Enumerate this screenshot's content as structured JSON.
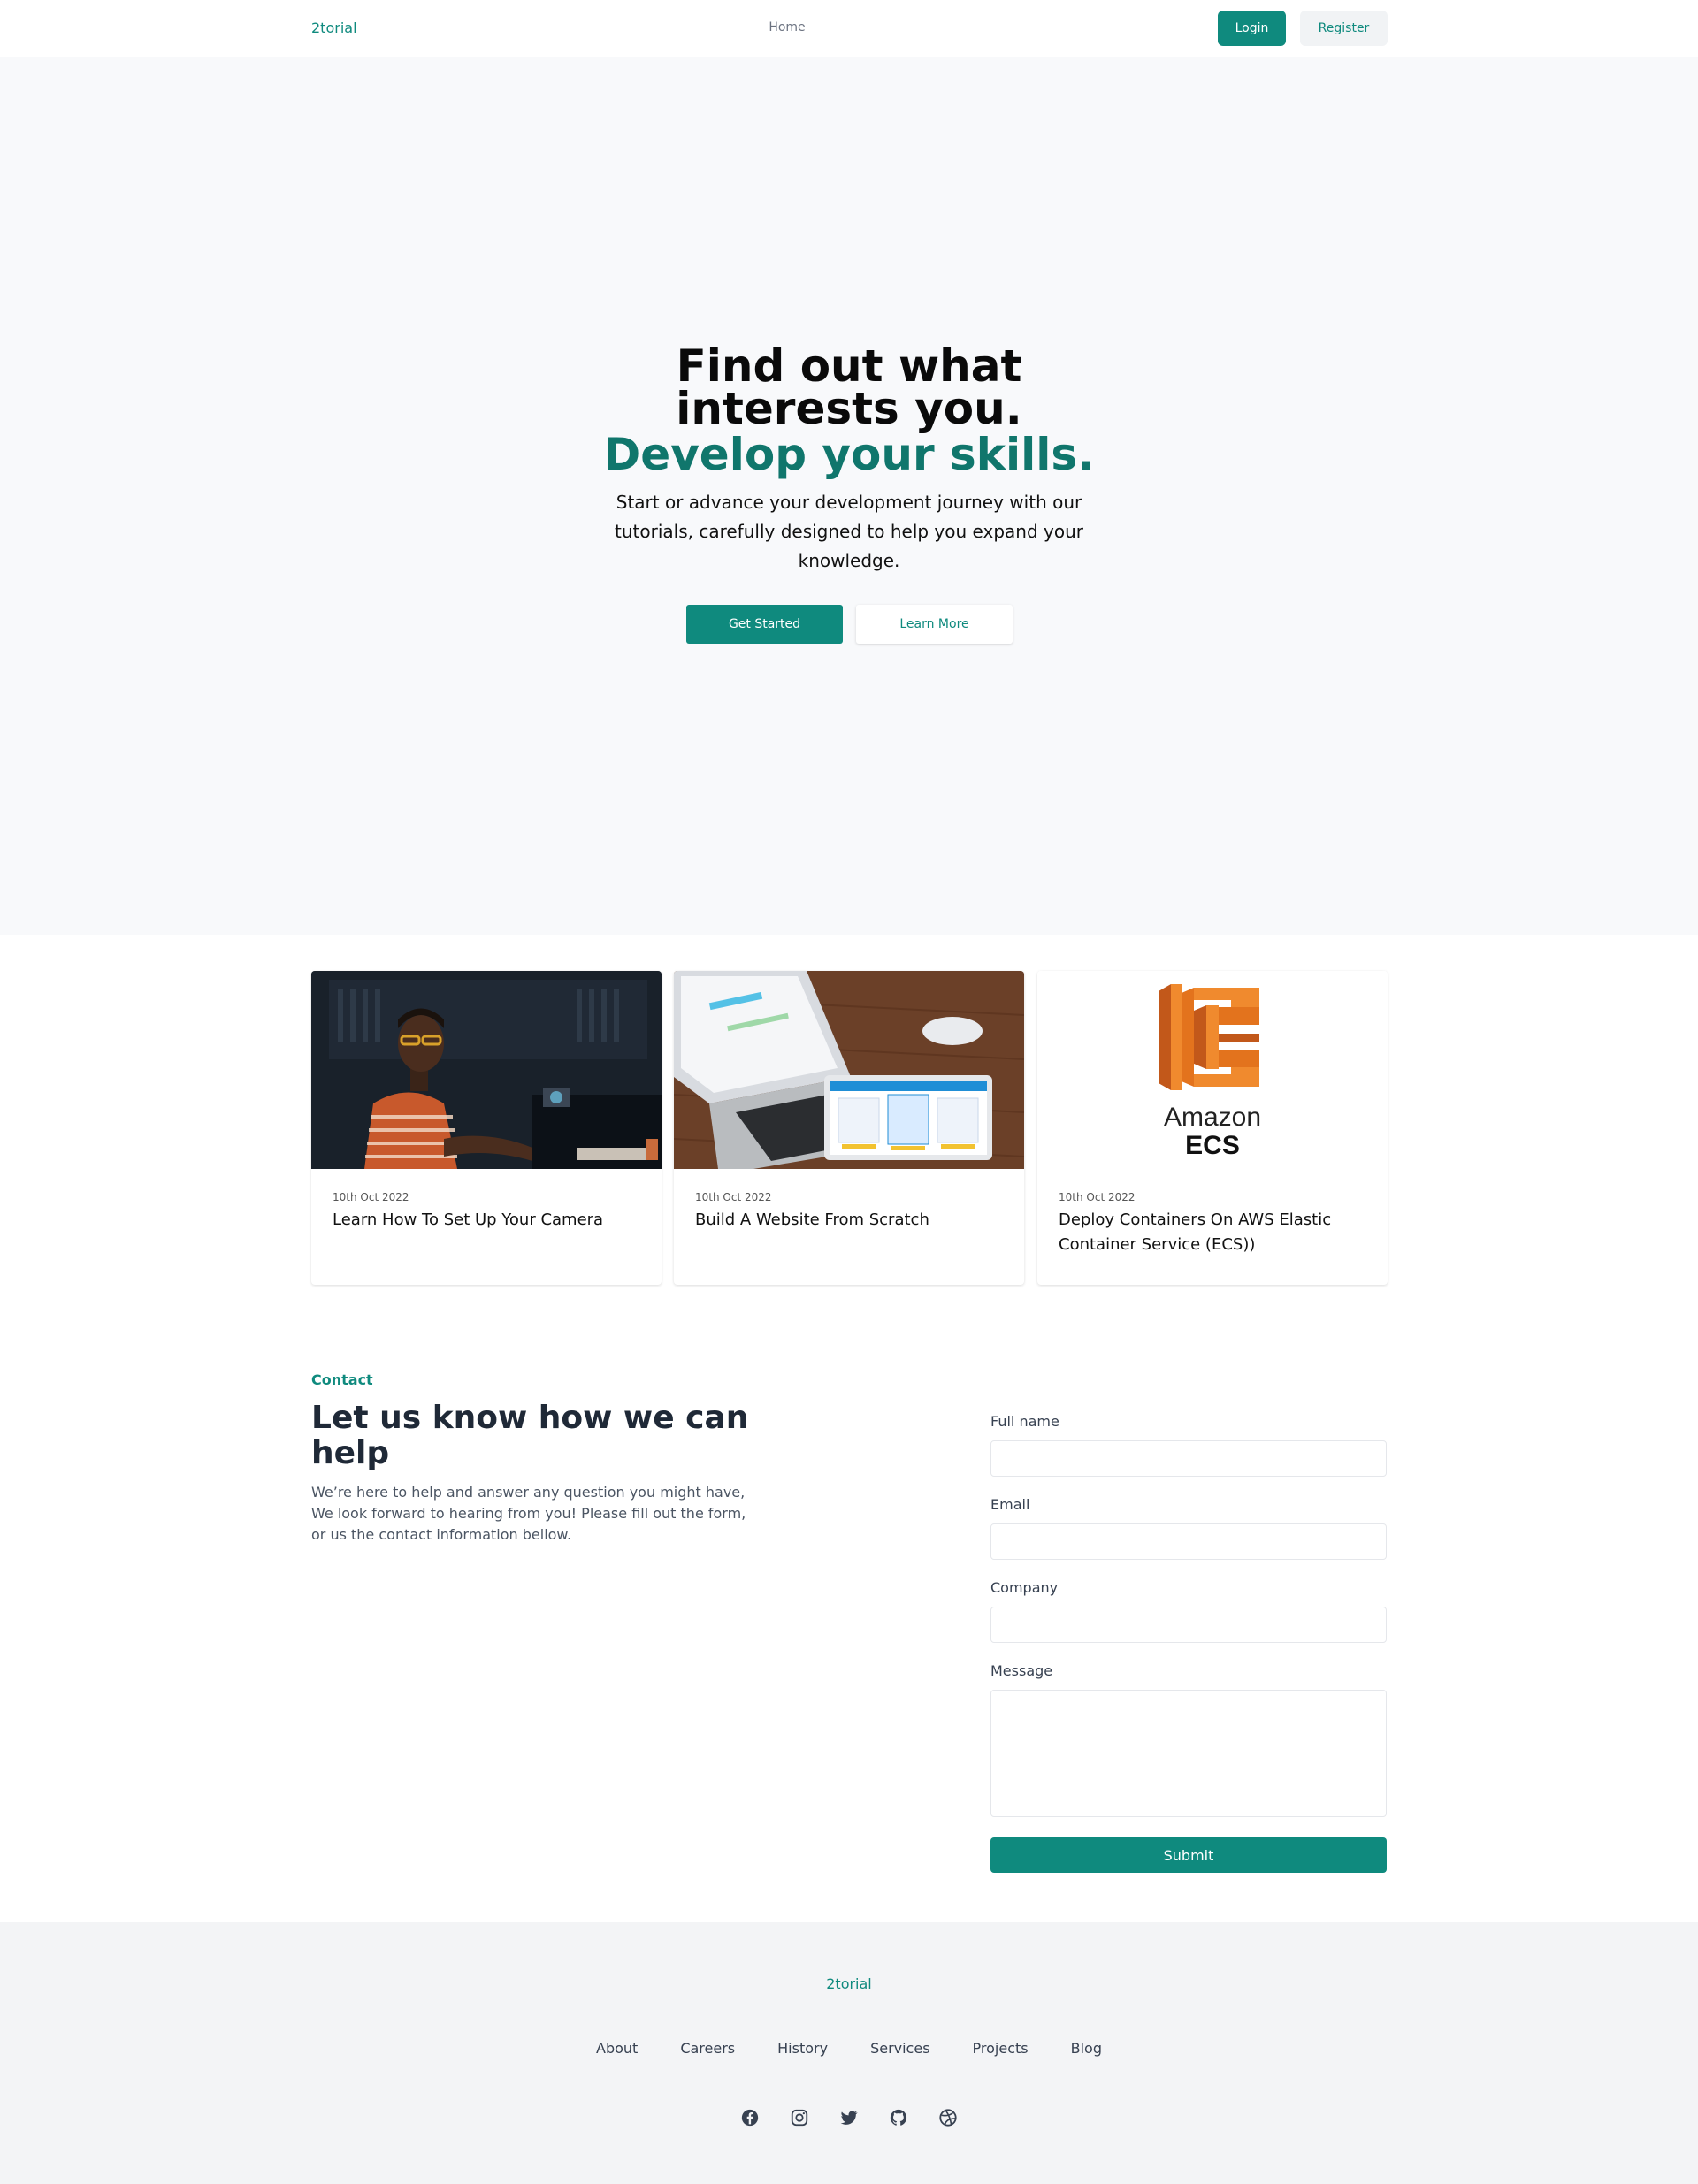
{
  "nav": {
    "logo": "2torial",
    "home": "Home",
    "login": "Login",
    "register": "Register"
  },
  "hero": {
    "title_line1": "Find out what",
    "title_line2": "interests you.",
    "accent": "Develop your skills.",
    "subtitle": "Start or advance your development journey with our tutorials, carefully designed to help you expand your knowledge.",
    "primary_button": "Get Started",
    "secondary_button": "Learn More"
  },
  "cards": [
    {
      "date": "10th Oct 2022",
      "title": "Learn How To Set Up Your Camera",
      "image": "man-at-desk-photo"
    },
    {
      "date": "10th Oct 2022",
      "title": "Build A Website From Scratch",
      "image": "laptop-tablet-photo"
    },
    {
      "date": "10th Oct 2022",
      "title": "Deploy Containers On AWS Elastic Container Service (ECS))",
      "image": "amazon-ecs-logo",
      "logo_text_1": "Amazon",
      "logo_text_2": "ECS"
    }
  ],
  "contact": {
    "kicker": "Contact",
    "heading": "Let us know how we can help",
    "description": "We’re here to help and answer any question you might have, We look forward to hearing from you! Please fill out the form, or us the contact information bellow.",
    "fields": {
      "full_name_label": "Full name",
      "email_label": "Email",
      "company_label": "Company",
      "message_label": "Message"
    },
    "submit": "Submit"
  },
  "footer": {
    "logo": "2torial",
    "links": [
      "About",
      "Careers",
      "History",
      "Services",
      "Projects",
      "Blog"
    ],
    "social_icons": [
      "facebook-icon",
      "instagram-icon",
      "twitter-icon",
      "github-icon",
      "dribbble-icon"
    ]
  },
  "colors": {
    "accent": "#0f8a7e",
    "accent_dark": "#10766c",
    "hero_bg": "#f8f9fb",
    "footer_bg": "#f3f4f6"
  }
}
